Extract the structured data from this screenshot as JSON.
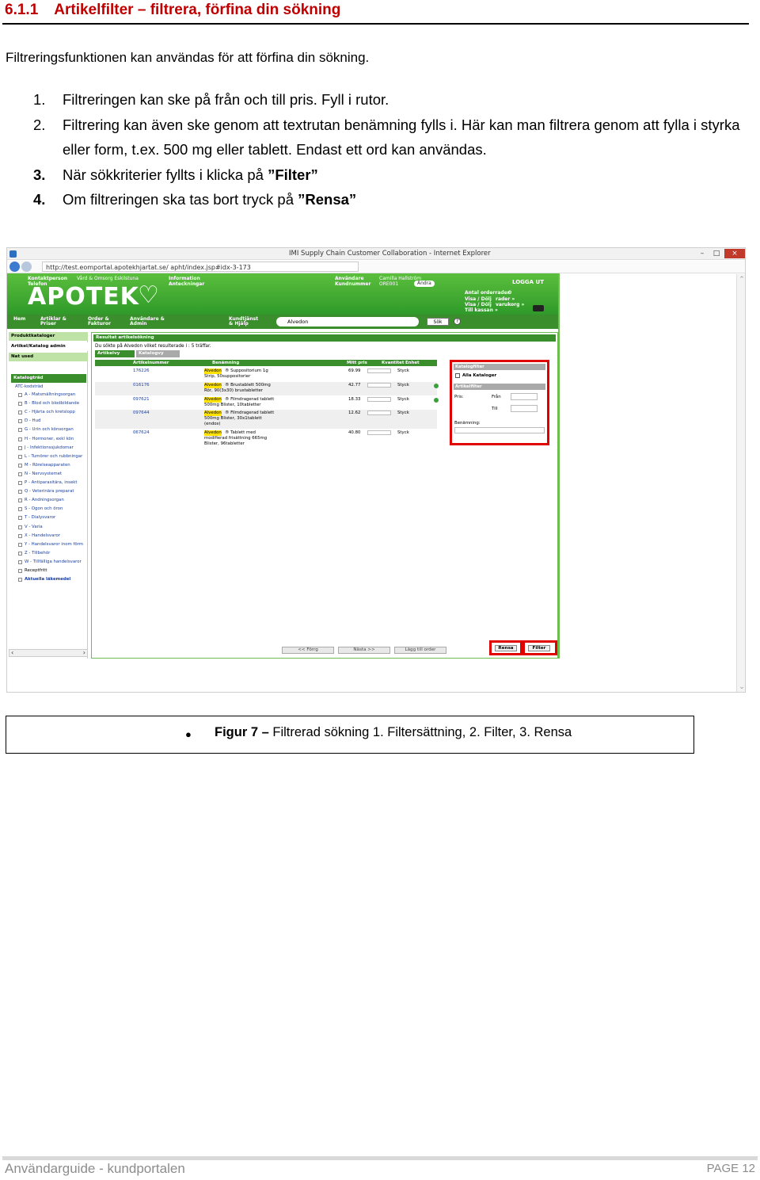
{
  "heading": {
    "number": "6.1.1",
    "title": "Artikelfilter – filtrera, förfina din sökning"
  },
  "intro": "Filtreringsfunktionen kan användas för att förfina din sökning.",
  "steps": [
    {
      "n": "1.",
      "text": "Filtreringen kan ske på från och till pris. Fyll i rutor."
    },
    {
      "n": "2.",
      "text": "Filtrering kan även ske genom att textrutan benämning fylls i. Här kan man filtrera genom att fylla i styrka eller form, t.ex. 500 mg eller tablett. Endast ett ord kan användas."
    },
    {
      "n": "3.",
      "pre": "När sökkriterier fyllts i klicka på ",
      "bold": "”Filter”"
    },
    {
      "n": "4.",
      "pre": "Om filtreringen ska tas bort tryck på ",
      "bold": "”Rensa”"
    }
  ],
  "screenshot": {
    "window_title": "IMI Supply Chain Customer Collaboration - Internet Explorer",
    "address": "http://test.eomportal.apotekhjartat.se/ apht/index.jsp#idx-3-173",
    "brand": "APOTEK",
    "header": {
      "kontakt": "Kontaktperson",
      "kontakt_val": "Vård & Omsorg Eskilstuna",
      "telefon": "Telefon",
      "information": "Information",
      "anteckningar": "Anteckningar",
      "anvandare": "Användare",
      "anvandare_val": "Camilla Hallström",
      "kundnummer": "Kundnummer",
      "kundnummer_val": "ORE001",
      "andra": "Ändra",
      "logout": "LOGGA UT",
      "antal": "Antal orderrader",
      "antal_val": "0",
      "visa_dol_1": "Visa / Dölj",
      "visa_dol_1b": "rader »",
      "visa_dol_2": "Visa / Dölj",
      "visa_dol_2b": "varukorg »",
      "till_kassan": "Till kassan »"
    },
    "menu": [
      "Hem",
      "Artiklar & Priser",
      "Order & Fakturor",
      "Användare & Admin",
      "Kundtjänst & Hjälp"
    ],
    "search_value": "Alvedon",
    "search_button": "Sök",
    "help": "?",
    "side_links": [
      "Produktkataloger",
      "Artikel/Katalog admin",
      "Nat used"
    ],
    "katalog_title": "Katalogträd",
    "tree_root": "ATC-kodsträd",
    "tree_items": [
      "A - Matsmältningsorgan",
      "B - Blod och blodbildande",
      "C - Hjärta och kretslopp",
      "D - Hud",
      "G - Urin och könsorgan",
      "H - Hormoner, exkl kön",
      "J - Infektionssjukdomar",
      "L - Tumörer och rubbningar",
      "M - Rörelseapparaten",
      "N - Nervsystemet",
      "P - Antiparasitära, insekt",
      "Q - Veterinära preparat",
      "R - Andningsorgan",
      "S - Ögon och öron",
      "T - Dialysvaror",
      "V - Varia",
      "X - Handelsvaror",
      "Y - Handelsvaror inom förm",
      "Z - Tillbehör",
      "W - Tillfälliga handelsvaror",
      "Receptfritt",
      "Aktuella läkemedel"
    ],
    "result_title": "Resultat artikelsökning",
    "result_text": "Du sökte på Alvedon vilket resulterade i : 5 träffar.",
    "tabs": [
      "Artikelvy",
      "Katalogvy"
    ],
    "columns": [
      "Artikelnummer",
      "Benämning",
      "Mitt pris",
      "Kvantitet",
      "Enhet"
    ],
    "rows": [
      {
        "id": "176226",
        "brand": "Alvedon",
        "desc1": "® Suppositorium 1g",
        "desc2": "Strip, 50suppositorier",
        "desc3": "",
        "desc4": "",
        "price": "69.99",
        "unit": "Styck",
        "dot": false
      },
      {
        "id": "016176",
        "brand": "Alvedon",
        "desc1": "® Brustablett 500mg",
        "desc2": "Rör, 90(3x30) brustabletter",
        "desc3": "",
        "desc4": "",
        "price": "42.77",
        "unit": "Styck",
        "dot": true
      },
      {
        "id": "097621",
        "brand": "Alvedon",
        "desc1": "® Filmdragerad tablett",
        "desc2": "500mg Blister, 10tabletter",
        "desc3": "",
        "desc4": "",
        "price": "18.33",
        "unit": "Styck",
        "dot": true
      },
      {
        "id": "097644",
        "brand": "Alvedon",
        "desc1": "® Filmdragerad tablett",
        "desc2": "500mg Blister, 30x1tablett",
        "desc3": "(endos)",
        "desc4": "",
        "price": "12.62",
        "unit": "Styck",
        "dot": false
      },
      {
        "id": "067624",
        "brand": "Alvedon",
        "desc1": "® Tablett med",
        "desc2": "modifierad frisättning 665mg",
        "desc3": "Blister, 96tabletter",
        "desc4": "",
        "price": "40.80",
        "unit": "Styck",
        "dot": false
      }
    ],
    "filter": {
      "katalog_head": "Katalogfilter",
      "alla": "Alla Kataloger",
      "artikel_head": "Artikelfilter",
      "pris": "Pris:",
      "fran": "Från",
      "till": "Till",
      "benamning": "Benämning:"
    },
    "bottom_buttons": [
      "<< Förrg",
      "Nästa >>",
      "Lägg till order"
    ],
    "rensa": "Rensa",
    "filter_btn": "Filter"
  },
  "caption": {
    "label": "Figur 7",
    "dash": " – ",
    "text": "Filtrerad sökning 1. Filtersättning, 2. Filter, 3. Rensa"
  },
  "footer": {
    "left": "Användarguide - kundportalen",
    "right": "PAGE 12"
  }
}
